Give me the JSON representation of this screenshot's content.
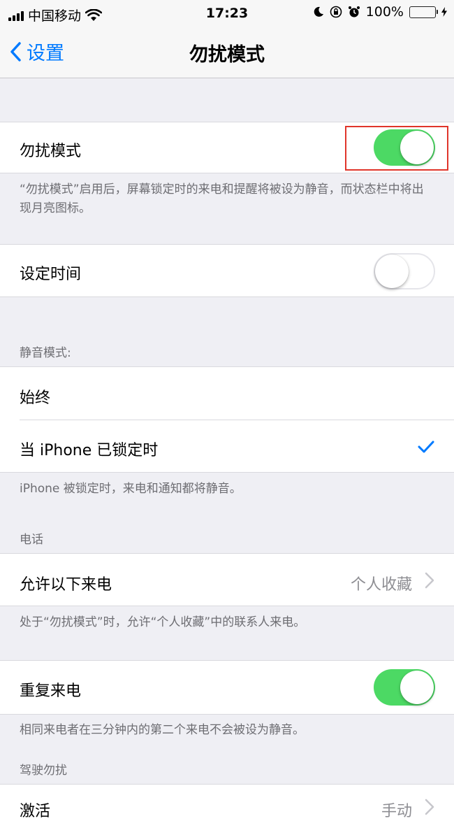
{
  "status_bar": {
    "carrier": "中国移动",
    "time": "17:23",
    "battery": "100%"
  },
  "nav": {
    "back_label": "设置",
    "title": "勿扰模式"
  },
  "dnd": {
    "label": "勿扰模式",
    "enabled": true,
    "footnote": "“勿扰模式”启用后，屏幕锁定时的来电和提醒将被设为静音，而状态栏中将出现月亮图标。"
  },
  "scheduled": {
    "label": "设定时间",
    "enabled": false
  },
  "silence": {
    "header": "静音模式:",
    "options": [
      {
        "label": "始终",
        "selected": false
      },
      {
        "label": "当 iPhone 已锁定时",
        "selected": true
      }
    ],
    "footnote": "iPhone 被锁定时，来电和通知都将静音。"
  },
  "phone": {
    "header": "电话",
    "allow_calls_label": "允许以下来电",
    "allow_calls_value": "个人收藏",
    "footnote": "处于“勿扰模式”时，允许“个人收藏”中的联系人来电。",
    "repeated_calls_label": "重复来电",
    "repeated_calls_enabled": true,
    "repeated_footnote": "相同来电者在三分钟内的第二个来电不会被设为静音。"
  },
  "driving": {
    "header": "驾驶勿扰",
    "activate_label": "激活",
    "activate_value": "手动"
  },
  "colors": {
    "accent": "#007aff",
    "switch_on": "#4cd964",
    "highlight": "#e0352b"
  }
}
